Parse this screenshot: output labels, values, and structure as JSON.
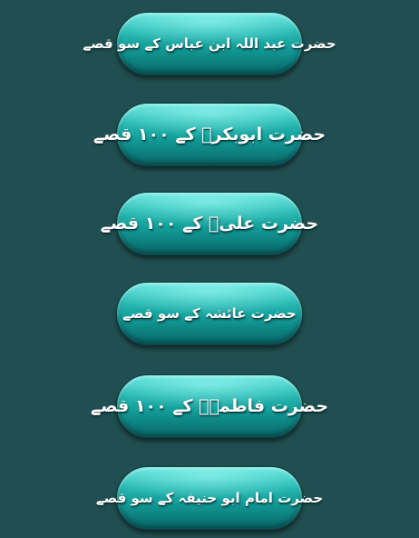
{
  "menu": {
    "items": [
      {
        "label": "حضرت عبد اللہ ابن عباس کے سو قصے"
      },
      {
        "label": "حضرت ابوبکرؓ کے ۱۰۰ قصے"
      },
      {
        "label": "حضرت علیؓ کے ۱۰۰ قصے"
      },
      {
        "label": "حضرت عائشہ کے سو قصے"
      },
      {
        "label": "حضرت فاطمہؓ کے ۱۰۰ قصے"
      },
      {
        "label": "حضرت امام ابو حنیفہ کے سو قصے"
      }
    ]
  },
  "colors": {
    "background": "#214e50",
    "button_top": "#5fe3db",
    "button_mid": "#14a09b",
    "button_bottom": "#0a6668",
    "text": "#ffffff"
  }
}
